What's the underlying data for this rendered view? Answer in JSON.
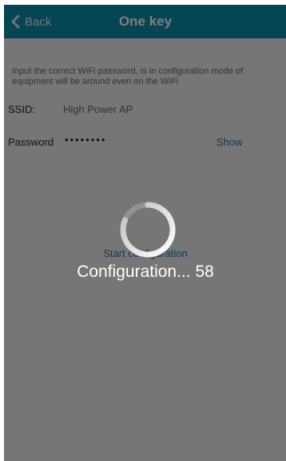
{
  "header": {
    "back_label": "Back",
    "title": "One key"
  },
  "form": {
    "instructions": "Input the correct WiFi password, is in configuration mode of equipment will be around even on the WiFi",
    "ssid_label": "SSID:",
    "ssid_value": "High Power AP",
    "password_label": "Password",
    "password_value": "••••••••",
    "show_label": "Show",
    "start_label": "Start configuration"
  },
  "overlay": {
    "progress_text": "Configuration... 58",
    "spinner_icon": "loading-spinner-icon"
  },
  "colors": {
    "header_bg": "#0d8aa6",
    "link": "#1e6fb8",
    "overlay": "rgba(0,0,0,0.5)"
  }
}
